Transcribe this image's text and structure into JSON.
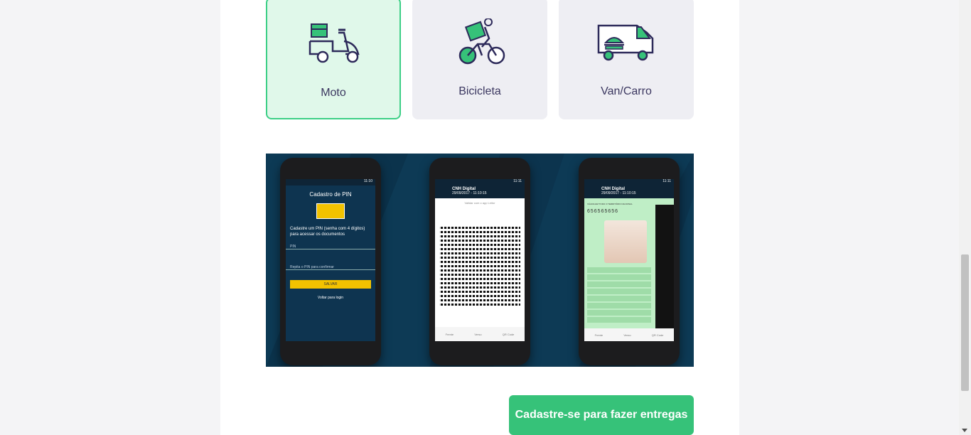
{
  "vehicles": [
    {
      "label": "Moto",
      "icon": "moto-icon",
      "selected": true
    },
    {
      "label": "Bicicleta",
      "icon": "bicycle-icon",
      "selected": false
    },
    {
      "label": "Van/Carro",
      "icon": "van-icon",
      "selected": false
    }
  ],
  "promo": {
    "phone1": {
      "status_time": "11:10",
      "title": "Cadastro de PIN",
      "instruction": "Cadastre um PIN (senha com 4 dígitos) para acessar os documentos",
      "pin_placeholder": "PIN",
      "confirm_placeholder": "Repita o PIN para confirmar",
      "save_label": "SALVAR",
      "back_label": "Voltar para login"
    },
    "phone2": {
      "status_time": "11:11",
      "title": "CNH Digital",
      "subtitle": "29/09/2017 - 11:10:15",
      "validate_text": "Validar com o app Leitor",
      "tabs": [
        "Frente",
        "Verso",
        "QR Code"
      ]
    },
    "phone3": {
      "status_time": "11:11",
      "title": "CNH Digital",
      "subtitle": "29/09/2017 - 11:10:15",
      "doc_number": "656565656",
      "valid_text": "VÁLIDA EM TODO O TERRITÓRIO NACIONAL",
      "tabs": [
        "Frente",
        "Verso",
        "QR Code"
      ]
    }
  },
  "cta_label": "Cadastre-se para fazer entregas",
  "colors": {
    "accent": "#36c279",
    "selected_bg": "#e0f8ea",
    "icon_stroke": "#2d2a5a"
  }
}
